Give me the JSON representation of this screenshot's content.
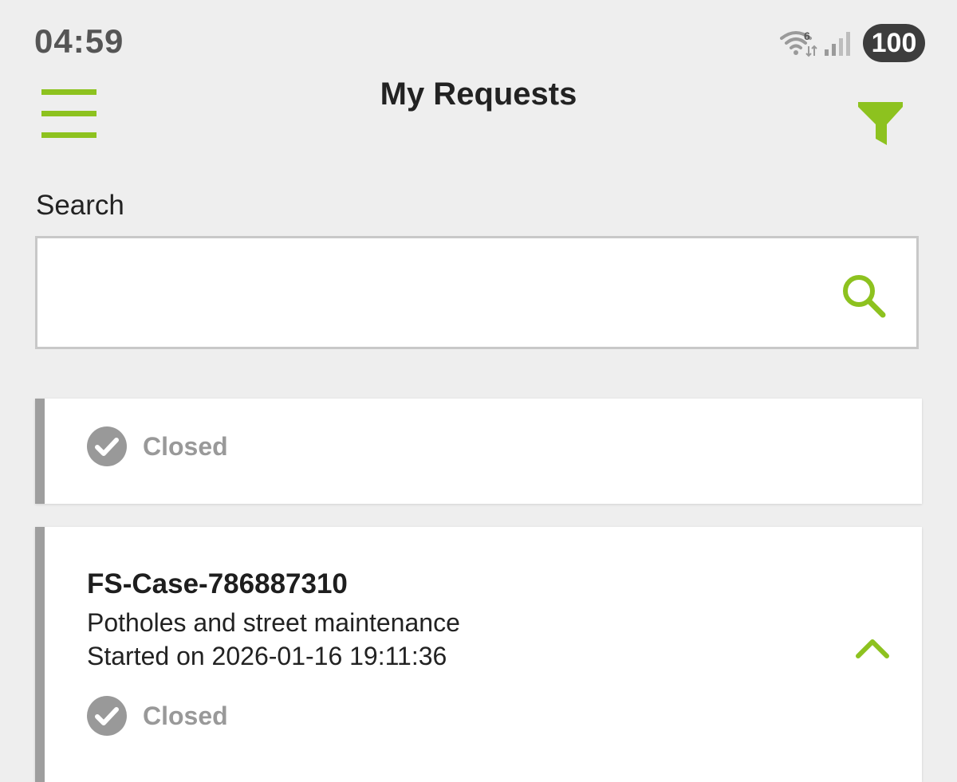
{
  "status_bar": {
    "time": "04:59",
    "battery": "100",
    "wifi_badge": "6"
  },
  "header": {
    "title": "My Requests",
    "menu_icon": "hamburger-menu-icon",
    "filter_icon": "filter-funnel-icon"
  },
  "search": {
    "label": "Search",
    "value": "",
    "placeholder": "",
    "icon": "search-icon"
  },
  "colors": {
    "accent": "#8dc21f",
    "status_closed": "#999999",
    "card_stripe": "#9e9e9e"
  },
  "requests": [
    {
      "status": "Closed",
      "status_icon": "check-circle-icon"
    },
    {
      "case_id": "FS-Case-786887310",
      "category": "Potholes and street maintenance",
      "started": "Started on 2026-01-16 19:11:36",
      "status": "Closed",
      "status_icon": "check-circle-icon",
      "toggle_icon": "chevron-up-icon"
    }
  ]
}
